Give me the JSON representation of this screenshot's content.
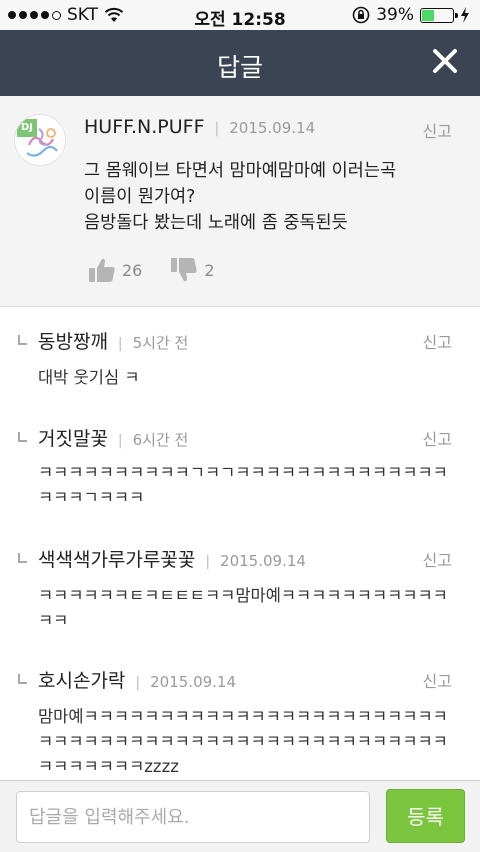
{
  "status_bar": {
    "carrier": "SKT",
    "time": "오전 12:58",
    "battery_percent": "39%",
    "battery_level": 0.39,
    "icons": [
      "signal-dots-icon",
      "wifi-icon",
      "orientation-lock-icon",
      "battery-icon",
      "charging-bolt-icon"
    ]
  },
  "nav": {
    "title": "답글",
    "close_icon": "close-icon",
    "background": "#3b4452"
  },
  "original_post": {
    "badge": "DJ",
    "author": "HUFF.N.PUFF",
    "date": "2015.09.14",
    "report_label": "신고",
    "text": "그 몸웨이브 타면서 맘마예맘마예 이러는곡\n이름이 뭔가여?\n음방돌다 봤는데 노래에 좀 중독된듯",
    "likes": "26",
    "dislikes": "2"
  },
  "replies": [
    {
      "author": "동방짱깨",
      "date": "5시간 전",
      "report_label": "신고",
      "text": "대박 웃기심 ㅋ"
    },
    {
      "author": "거짓말꽃",
      "date": "6시간 전",
      "report_label": "신고",
      "text": "ㅋㅋㅋㅋㅋㅋㅋㅋㅋㅋㄱㅋㄱㅋㅋㅋㅋㅋㅋㅋㅋㅋㅋㅋㅋㅋㅋㅋㅋㅋㄱㅋㅋㅋ"
    },
    {
      "author": "색색색가루가루꽃꽃",
      "date": "2015.09.14",
      "report_label": "신고",
      "text": "ㅋㅋㅋㅋㅋㅋㅌㅋㅌㅌㅌㅋㅋ맘마예ㅋㅋㅋㅋㅋㅋㅋㅋㅋㅋㅋㅋㅋ"
    },
    {
      "author": "호시손가락",
      "date": "2015.09.14",
      "report_label": "신고",
      "text": "맘마예ㅋㅋㅋㅋㅋㅋㅋㅋㅋㅋㅋㅋㅋㅋㅋㅋㅋㅋㅋㅋㅋㅋㅋㅋㅋㅋㅋㅋㅋㅋㅋㅋㅋㅋㅋㅋㅋㅋㅋㅋㅋㅋㅋㅋㅋㅋㅋㅋㅋㅋㅋㅋㅋㅋㅋㅋㅋㅋzzzz"
    }
  ],
  "input_bar": {
    "placeholder": "답글을 입력해주세요.",
    "value": "",
    "submit_label": "등록",
    "submit_color": "#7cc53f"
  }
}
